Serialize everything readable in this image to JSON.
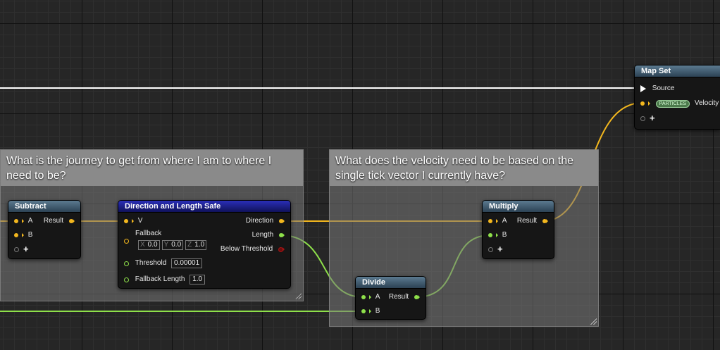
{
  "comments": [
    {
      "title": "What is the journey to get from where I am to where I need to be?"
    },
    {
      "title": "What does the velocity need to be based on the single tick vector I currently have?"
    }
  ],
  "nodes": {
    "subtract": {
      "title": "Subtract",
      "pins": {
        "a": "A",
        "b": "B",
        "result": "Result"
      }
    },
    "direction_length": {
      "title": "Direction and Length Safe",
      "pins": {
        "v": "V",
        "fallback": "Fallback",
        "threshold": "Threshold",
        "fallback_length": "Fallback Length",
        "direction": "Direction",
        "length": "Length",
        "below_threshold": "Below Threshold"
      },
      "fallback_vector": {
        "x_axis": "X",
        "x": "0.0",
        "y_axis": "Y",
        "y": "0.0",
        "z_axis": "Z",
        "z": "1.0"
      },
      "threshold_value": "0.00001",
      "fallback_length_value": "1.0"
    },
    "multiply": {
      "title": "Multiply",
      "pins": {
        "a": "A",
        "b": "B",
        "result": "Result"
      }
    },
    "divide": {
      "title": "Divide",
      "pins": {
        "a": "A",
        "b": "B",
        "result": "Result"
      }
    },
    "map_set": {
      "title": "Map Set",
      "pins": {
        "source": "Source",
        "velocity": "Velocity"
      },
      "namespace_badge": "PARTICLES"
    }
  },
  "colors": {
    "vector_wire": "#f3b71e",
    "float_wire": "#8ee04a",
    "exec_wire": "#ffffff",
    "bool_pin": "#a51414",
    "comment_header": "#8a8a8a"
  }
}
